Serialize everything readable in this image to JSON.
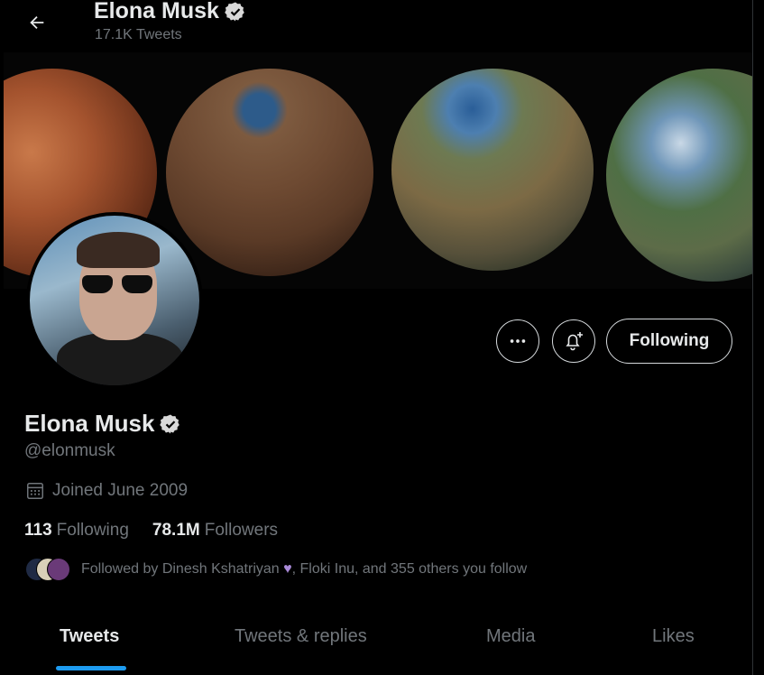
{
  "header": {
    "back_icon": "arrow-left-icon",
    "name": "Elona Musk",
    "tweet_count": "17.1K Tweets"
  },
  "banner": {
    "description_icon": "planets-banner"
  },
  "actions": {
    "more_icon": "ellipsis-icon",
    "notify_icon": "bell-plus-icon",
    "following_label": "Following"
  },
  "profile": {
    "name": "Elona Musk",
    "verified_icon": "verified-badge-icon",
    "handle": "@elonmusk",
    "joined": "Joined June 2009",
    "calendar_icon": "calendar-icon",
    "following_count": "113",
    "following_label": "Following",
    "followers_count": "78.1M",
    "followers_label": "Followers",
    "followed_by_prefix": "Followed by Dinesh Kshatriyan",
    "followed_by_suffix": ", Floki Inu, and 355 others you follow"
  },
  "tabs": [
    {
      "label": "Tweets",
      "active": true
    },
    {
      "label": "Tweets & replies",
      "active": false
    },
    {
      "label": "Media",
      "active": false
    },
    {
      "label": "Likes",
      "active": false
    }
  ],
  "colors": {
    "background": "#000000",
    "accent": "#1d9bf0",
    "muted_text": "#71767b",
    "primary_text": "#e7e9ea"
  }
}
